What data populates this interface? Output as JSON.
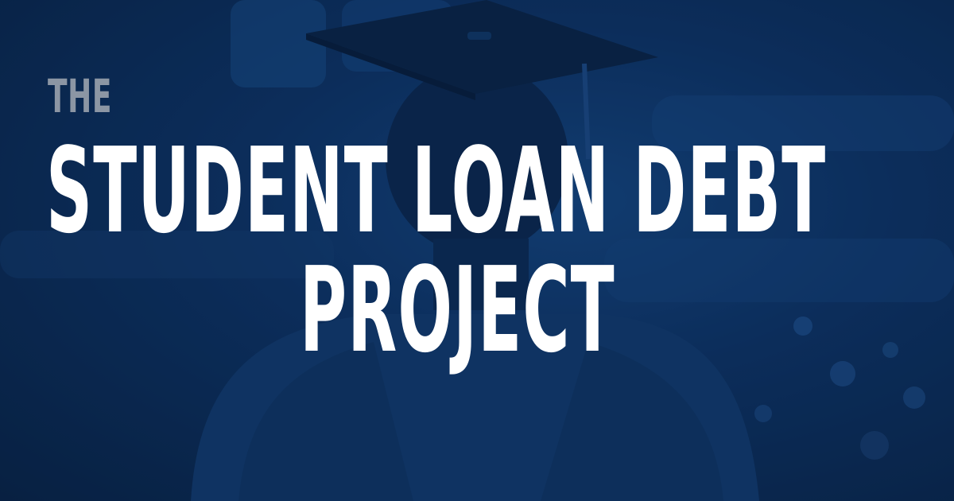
{
  "banner": {
    "eyebrow": "THE",
    "headline_line_1": "STUDENT LOAN DEBT",
    "headline_line_2": "PROJECT"
  },
  "background": {
    "description_icon": "graduate-photo",
    "tint_color": "#0e3466"
  },
  "colors": {
    "eyebrow": "#8c96a4",
    "headline": "#ffffff",
    "background_dark": "#08203f",
    "background_mid": "#164a86"
  }
}
